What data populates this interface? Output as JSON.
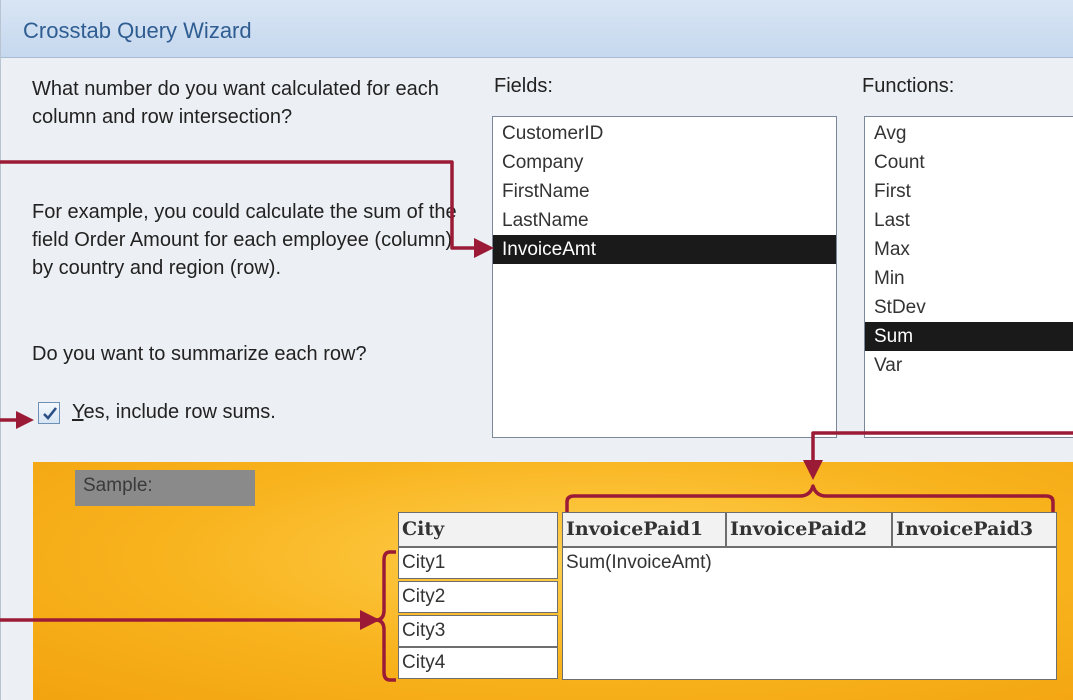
{
  "window": {
    "title": "Crosstab Query Wizard"
  },
  "prompt": {
    "question": "What number do you want calculated for each column and row intersection?",
    "example": "For example, you could calculate the sum of the field Order Amount for each employee (column)  by country and region (row).",
    "summarize_question": "Do you want to summarize each row?",
    "row_sums": {
      "checked": true,
      "label_underlined": "Y",
      "label_rest": "es, include row sums."
    }
  },
  "fields": {
    "label": "Fields:",
    "items": [
      "CustomerID",
      "Company",
      "FirstName",
      "LastName",
      "InvoiceAmt"
    ],
    "selected": "InvoiceAmt"
  },
  "functions": {
    "label": "Functions:",
    "items": [
      "Avg",
      "Count",
      "First",
      "Last",
      "Max",
      "Min",
      "StDev",
      "Sum",
      "Var"
    ],
    "selected": "Sum"
  },
  "sample": {
    "label": "Sample:",
    "row_header": "City",
    "column_headers": [
      "InvoicePaid1",
      "InvoicePaid2",
      "InvoicePaid3"
    ],
    "rows": [
      "City1",
      "City2",
      "City3",
      "City4"
    ],
    "value": "Sum(InvoiceAmt)"
  },
  "colors": {
    "annotation": "#9b1b36",
    "panel": "#f8b31d",
    "selection": "#1a1a1a",
    "title": "#2f5d92"
  }
}
